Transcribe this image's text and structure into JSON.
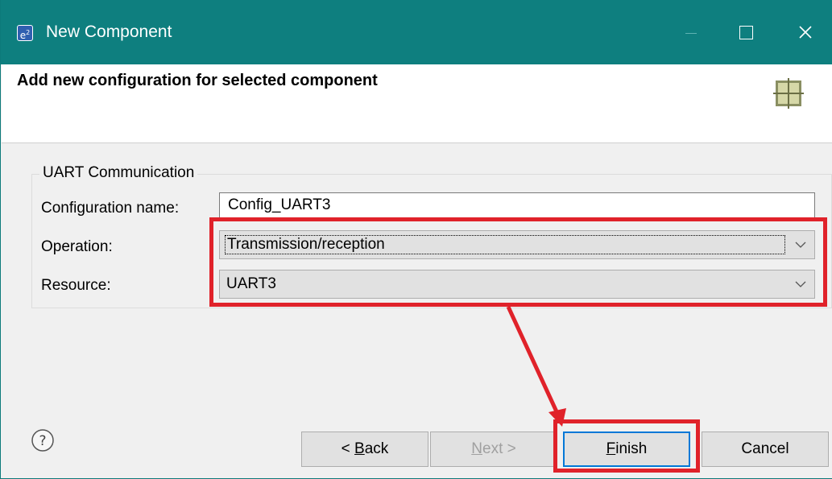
{
  "window": {
    "title": "New Component",
    "app_icon": "e2-icon"
  },
  "header": {
    "title": "Add new configuration for selected component",
    "icon": "component-grid-icon"
  },
  "group": {
    "label": "UART Communication",
    "fields": {
      "config_name_label": "Configuration name:",
      "config_name_value": "Config_UART3",
      "operation_label": "Operation:",
      "operation_value": "Transmission/reception",
      "resource_label": "Resource:",
      "resource_value": "UART3"
    }
  },
  "footer": {
    "help_icon": "question-circle-icon",
    "back_mnemonic": "B",
    "back_rest": "ack",
    "back_prefix": "< ",
    "next_mnemonic": "N",
    "next_rest": "ext >",
    "finish_mnemonic": "F",
    "finish_rest": "inish",
    "cancel_label": "Cancel"
  },
  "colors": {
    "titlebar": "#0e7f7f",
    "highlight": "#e0222a",
    "focus": "#0078d7"
  }
}
